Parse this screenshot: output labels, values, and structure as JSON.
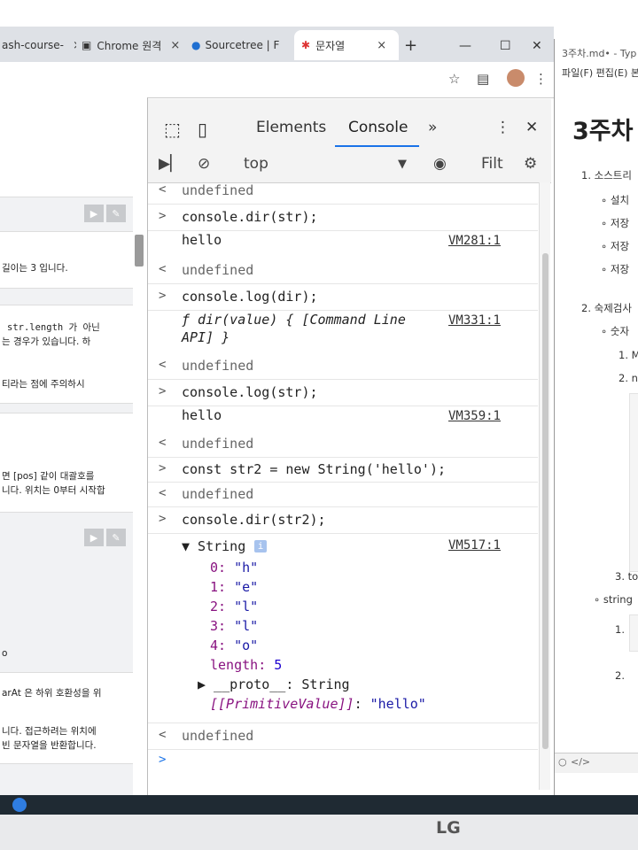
{
  "browser": {
    "tabs": [
      {
        "label": "ash-course-",
        "active": false
      },
      {
        "label": "Chrome 원격",
        "active": false
      },
      {
        "label": "Sourcetree | F",
        "active": false
      },
      {
        "label": "문자열",
        "active": true
      }
    ],
    "new_tab": "+",
    "close": "×"
  },
  "left_page": {
    "lines": [
      "길이는 3 입니다.",
      "str.length 가 아닌",
      "는 경우가 있습니다. 하",
      "티라는 점에 주의하시",
      "면 [pos] 같이 대괄호를",
      "니다. 위치는 0부터 시작합",
      "o",
      "arAt 은 하위 호환성을 위",
      "니다. 접근하려는 위치에",
      "빈 문자열을 반환합니다."
    ]
  },
  "devtools": {
    "tabs": [
      "Elements",
      "Console",
      "»"
    ],
    "active_tab": "Console",
    "context": "top",
    "filter_placeholder": "Filt",
    "console_rows": [
      {
        "prefix": "<",
        "text": "undefined",
        "kind": "result"
      },
      {
        "prefix": ">",
        "text": "console.dir(str);",
        "kind": "input"
      },
      {
        "prefix": "",
        "text": "hello",
        "source": "VM281:1",
        "kind": "output"
      },
      {
        "prefix": "<",
        "text": "undefined",
        "kind": "result"
      },
      {
        "prefix": ">",
        "text": "console.log(dir);",
        "kind": "input"
      },
      {
        "prefix": "",
        "text": "ƒ dir(value) { [Command Line",
        "text2": "API] }",
        "source": "VM331:1",
        "kind": "output"
      },
      {
        "prefix": "<",
        "text": "undefined",
        "kind": "result"
      },
      {
        "prefix": ">",
        "text": "console.log(str);",
        "kind": "input"
      },
      {
        "prefix": "",
        "text": "hello",
        "source": "VM359:1",
        "kind": "output"
      },
      {
        "prefix": "<",
        "text": "undefined",
        "kind": "result"
      },
      {
        "prefix": ">",
        "text": "const str2 = new String('hello');",
        "kind": "input"
      },
      {
        "prefix": "<",
        "text": "undefined",
        "kind": "result"
      },
      {
        "prefix": ">",
        "text": "console.dir(str2);",
        "kind": "input"
      }
    ],
    "object_output": {
      "header": "▼ String",
      "source": "VM517:1",
      "props": [
        {
          "key": "0",
          "value": "\"h\""
        },
        {
          "key": "1",
          "value": "\"e\""
        },
        {
          "key": "2",
          "value": "\"l\""
        },
        {
          "key": "3",
          "value": "\"l\""
        },
        {
          "key": "4",
          "value": "\"o\""
        },
        {
          "key": "length",
          "value": "5"
        }
      ],
      "proto": "▶ __proto__: String",
      "primitive_key": "[[PrimitiveValue]]",
      "primitive_value": "\"hello\""
    },
    "final_result": "undefined",
    "prompt": ">"
  },
  "right_window": {
    "title": "3주차.md• - Typ",
    "menu": "파일(F)  편집(E)  본",
    "heading": "3주차",
    "items": [
      "1. 소스트리",
      "설치",
      "저장",
      "저장",
      "저장",
      "2. 숙제검사",
      "숫자",
      "1. M",
      "2. n",
      "3. to",
      "string",
      "1.",
      "2."
    ]
  },
  "monitor_brand": "LG"
}
